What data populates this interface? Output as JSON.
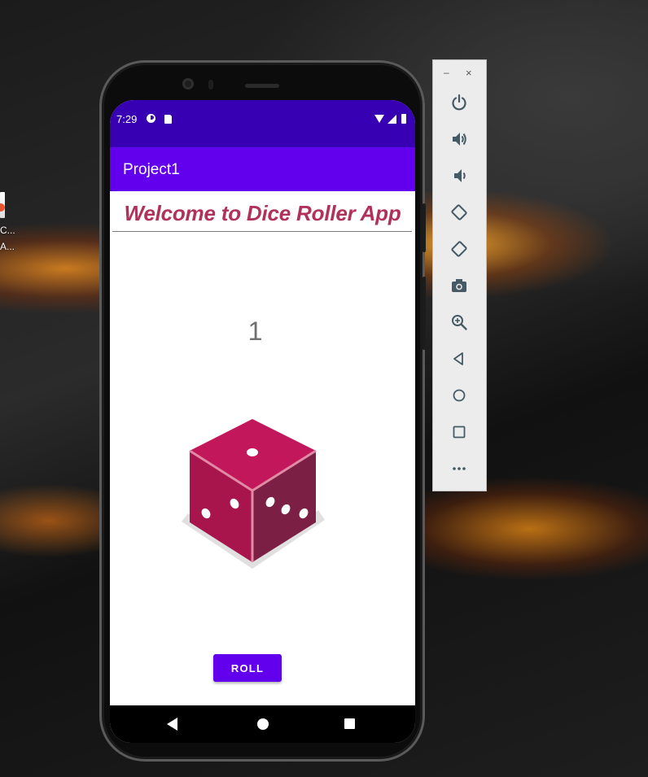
{
  "desktop": {
    "icon_label_line1": "C...",
    "icon_label_line2": "A..."
  },
  "status_bar": {
    "time": "7:29"
  },
  "app_bar": {
    "title": "Project1"
  },
  "main": {
    "welcome_text": "Welcome to Dice Roller App",
    "result_value": "1",
    "roll_button_label": "ROLL",
    "dice_icon": "dice-icon"
  },
  "emulator_toolbar": {
    "minimize_label": "–",
    "close_label": "×",
    "buttons": [
      "power-icon",
      "volume-up-icon",
      "volume-down-icon",
      "rotate-left-icon",
      "rotate-right-icon",
      "camera-icon",
      "zoom-icon",
      "back-icon",
      "home-icon",
      "overview-icon",
      "more-icon"
    ]
  },
  "colors": {
    "status_bar": "#3700b3",
    "app_bar": "#6200ee",
    "welcome_text": "#b0325a",
    "dice_face": "#c2185b"
  }
}
